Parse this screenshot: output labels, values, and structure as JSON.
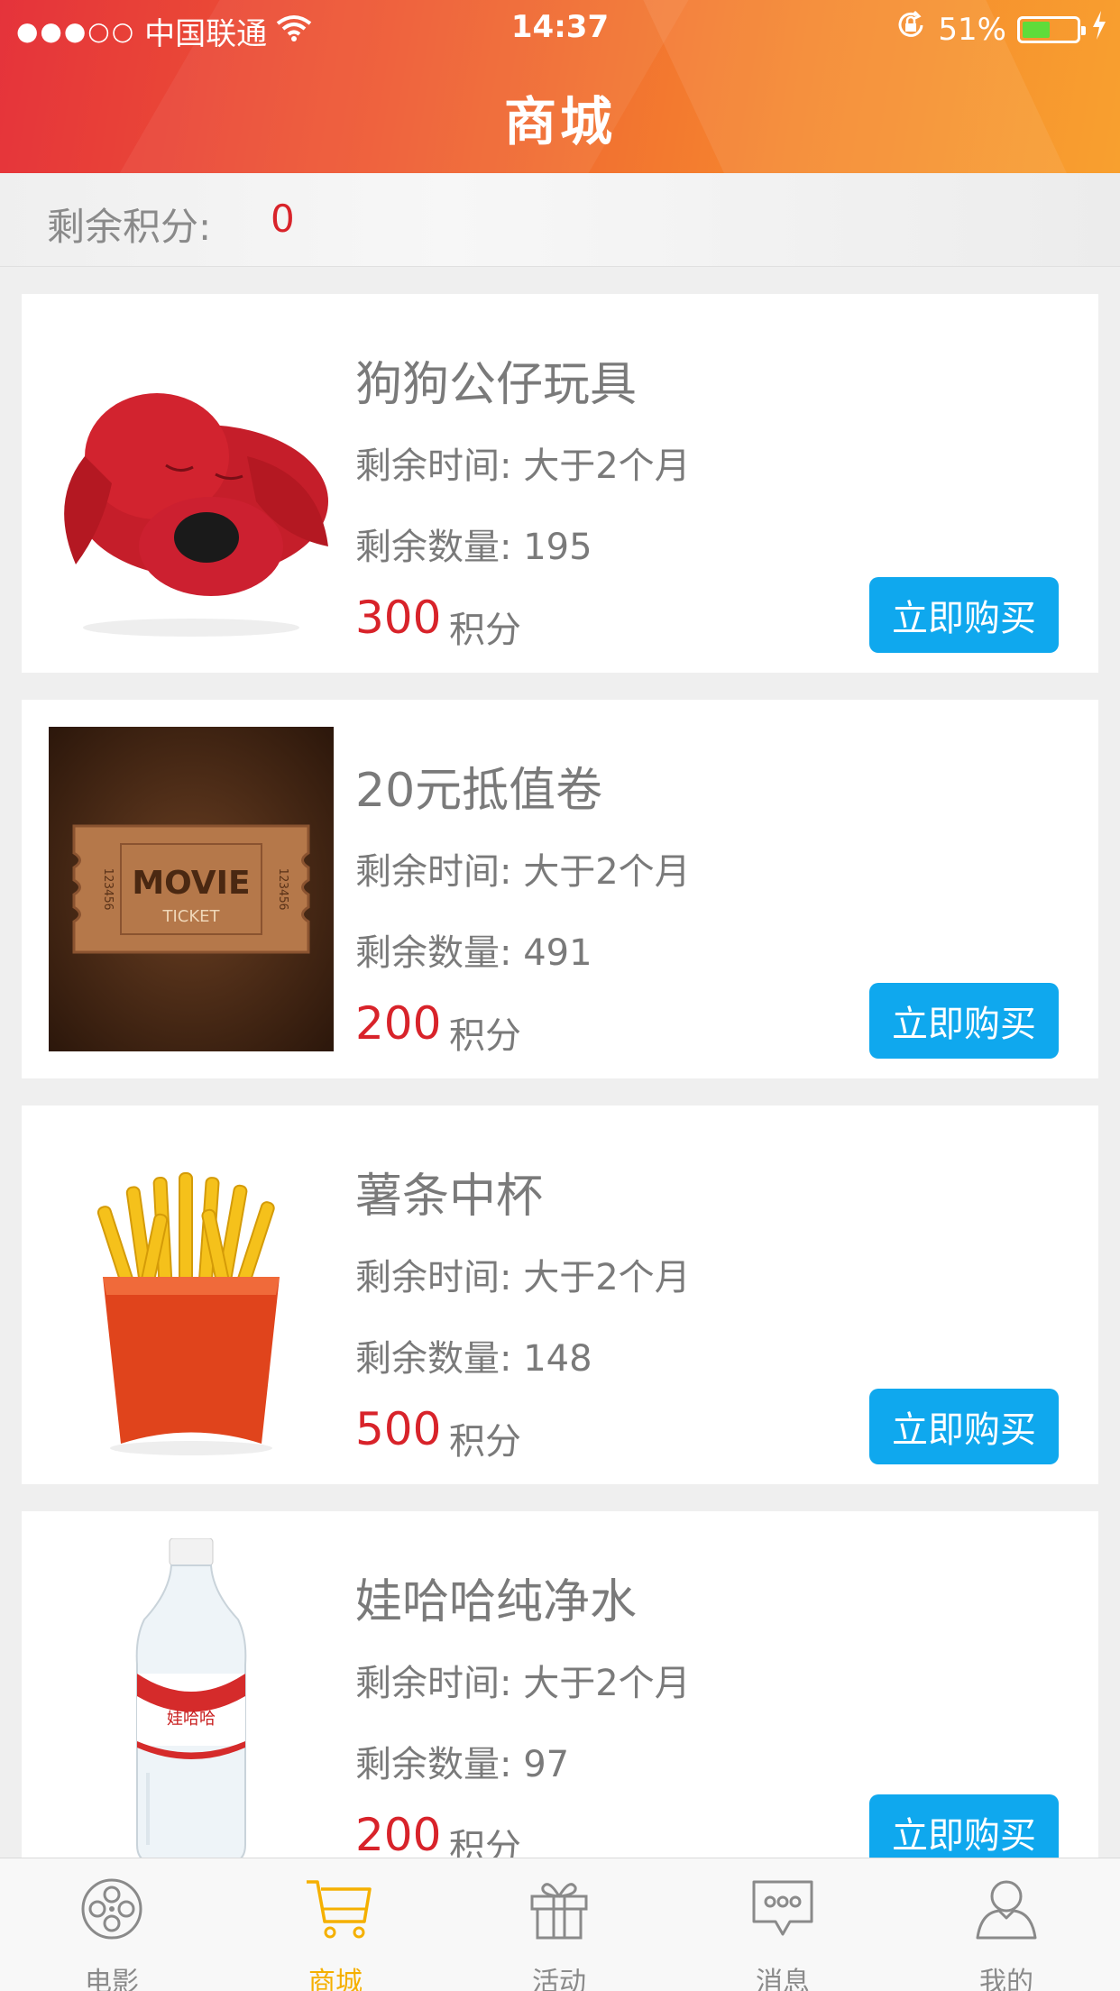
{
  "status_bar": {
    "signal": "●●●○○",
    "carrier": "中国联通",
    "time": "14:37",
    "battery_percent": "51%",
    "battery_level": 0.51
  },
  "header": {
    "title": "商城"
  },
  "points": {
    "label": "剩余积分:",
    "value": "0"
  },
  "items": [
    {
      "name": "狗狗公仔玩具",
      "time_text": "剩余时间:  大于2个月",
      "qty_text": "剩余数量:  195",
      "price": "300",
      "unit": "积分",
      "buy_label": "立即购买",
      "image_icon": "plush-dog-icon"
    },
    {
      "name": "20元抵值卷",
      "time_text": "剩余时间:  大于2个月",
      "qty_text": "剩余数量:  491",
      "price": "200",
      "unit": "积分",
      "buy_label": "立即购买",
      "image_icon": "movie-ticket-icon",
      "ticket_text": {
        "main": "MOVIE",
        "sub": "TICKET",
        "serial": "123456"
      }
    },
    {
      "name": "薯条中杯",
      "time_text": "剩余时间:  大于2个月",
      "qty_text": "剩余数量:  148",
      "price": "500",
      "unit": "积分",
      "buy_label": "立即购买",
      "image_icon": "french-fries-icon"
    },
    {
      "name": "娃哈哈纯净水",
      "time_text": "剩余时间:  大于2个月",
      "qty_text": "剩余数量:  97",
      "price": "200",
      "unit": "积分",
      "buy_label": "立即购买",
      "image_icon": "water-bottle-icon",
      "bottle_label": "娃哈哈"
    }
  ],
  "tabs": [
    {
      "label": "电影",
      "icon": "film-reel-icon",
      "active": false
    },
    {
      "label": "商城",
      "icon": "shopping-cart-icon",
      "active": true
    },
    {
      "label": "活动",
      "icon": "gift-icon",
      "active": false
    },
    {
      "label": "消息",
      "icon": "message-icon",
      "active": false
    },
    {
      "label": "我的",
      "icon": "user-icon",
      "active": false
    }
  ],
  "colors": {
    "header_start": "#e5333b",
    "header_end": "#f8a02f",
    "price": "#d8232a",
    "button": "#0fa8ee",
    "tab_active": "#f5b000"
  }
}
